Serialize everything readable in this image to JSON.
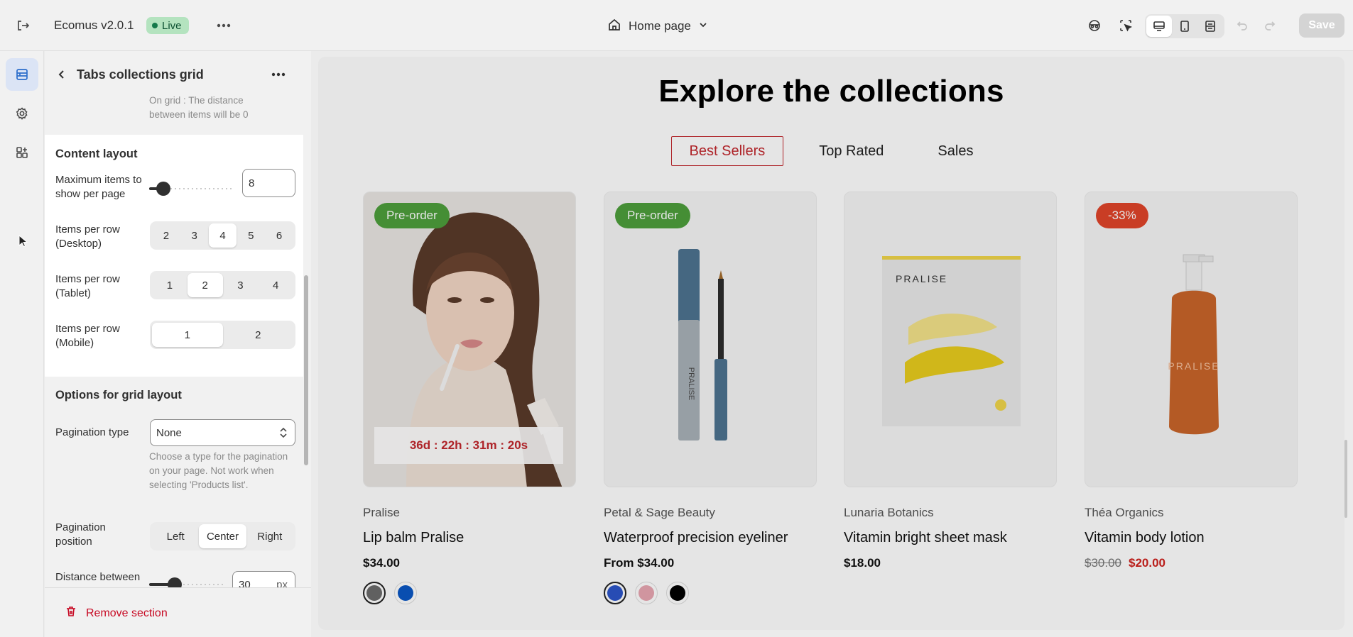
{
  "topbar": {
    "app_name": "Ecomus v2.0.1",
    "status": "Live",
    "page": "Home page",
    "save_label": "Save"
  },
  "panel": {
    "title": "Tabs collections grid",
    "top_note": "On grid : The distance between items will be 0",
    "content_layout": {
      "title": "Content layout",
      "max_items_label": "Maximum items to show per page",
      "max_items_value": "8",
      "max_items_fraction": 0.1,
      "desktop_label": "Items per row (Desktop)",
      "desktop_options": [
        "2",
        "3",
        "4",
        "5",
        "6"
      ],
      "desktop_selected": "4",
      "tablet_label": "Items per row (Tablet)",
      "tablet_options": [
        "1",
        "2",
        "3",
        "4"
      ],
      "tablet_selected": "2",
      "mobile_label": "Items per row (Mobile)",
      "mobile_options": [
        "1",
        "2"
      ],
      "mobile_selected": "1"
    },
    "grid_options": {
      "title": "Options for grid layout",
      "pagination_type_label": "Pagination type",
      "pagination_type_value": "None",
      "pagination_note": "Choose a type for the pagination on your page. Not work when selecting 'Products list'.",
      "pagination_position_label": "Pagination position",
      "position_options": [
        "Left",
        "Center",
        "Right"
      ],
      "position_selected": "Center",
      "distance_label": "Distance between",
      "distance_value": "30",
      "distance_unit": "px",
      "distance_fraction": 0.3
    },
    "remove_label": "Remove section"
  },
  "preview": {
    "heading": "Explore the collections",
    "tabs": [
      "Best Sellers",
      "Top Rated",
      "Sales"
    ],
    "active_tab": "Best Sellers",
    "products": [
      {
        "badge": "Pre-order",
        "badge_color": "#4d9f3c",
        "countdown": "36d : 22h : 31m : 20s",
        "vendor": "Pralise",
        "name": "Lip balm Pralise",
        "price": "$34.00",
        "swatches": [
          "#6b6b6b",
          "#0b57c4"
        ]
      },
      {
        "badge": "Pre-order",
        "badge_color": "#4d9f3c",
        "vendor": "Petal & Sage Beauty",
        "name": "Waterproof precision eyeliner",
        "price": "From $34.00",
        "swatches": [
          "#2c55c9",
          "#e8a6b1",
          "#000000"
        ]
      },
      {
        "vendor": "Lunaria Botanics",
        "name": "Vitamin bright sheet mask",
        "price": "$18.00",
        "package_text": "PRALISE"
      },
      {
        "badge": "-33%",
        "badge_color": "#e0442a",
        "vendor": "Théa Organics",
        "name": "Vitamin body lotion",
        "price_old": "$30.00",
        "price": "$20.00",
        "bottle_text": "PRALISE"
      }
    ]
  },
  "colors": {
    "accent_red": "#c2272d",
    "live_green": "#b4e3bf",
    "remove_red": "#c70a24"
  }
}
